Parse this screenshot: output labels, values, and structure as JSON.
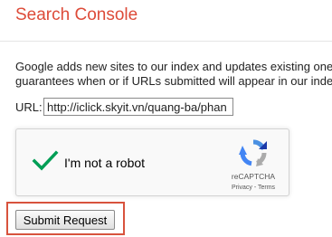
{
  "header": {
    "title": "Search Console",
    "title_color": "#dd4b39"
  },
  "main": {
    "description_lines": [
      "Google adds new sites to our index and updates existing one",
      "guarantees when or if URLs submitted will appear in our inde"
    ],
    "url_label": "URL:",
    "url_value": "http://iclick.skyit.vn/quang-ba/phan"
  },
  "recaptcha": {
    "checkbox_state": "checked",
    "checkmark_color": "#009e55",
    "label": "I'm not a robot",
    "brand": "reCAPTCHA",
    "privacy_link": "Privacy",
    "separator": " - ",
    "terms_link": "Terms",
    "logo_icon": "recaptcha-logo-icon"
  },
  "actions": {
    "submit_label": "Submit Request",
    "highlight_color": "#d8533d"
  }
}
